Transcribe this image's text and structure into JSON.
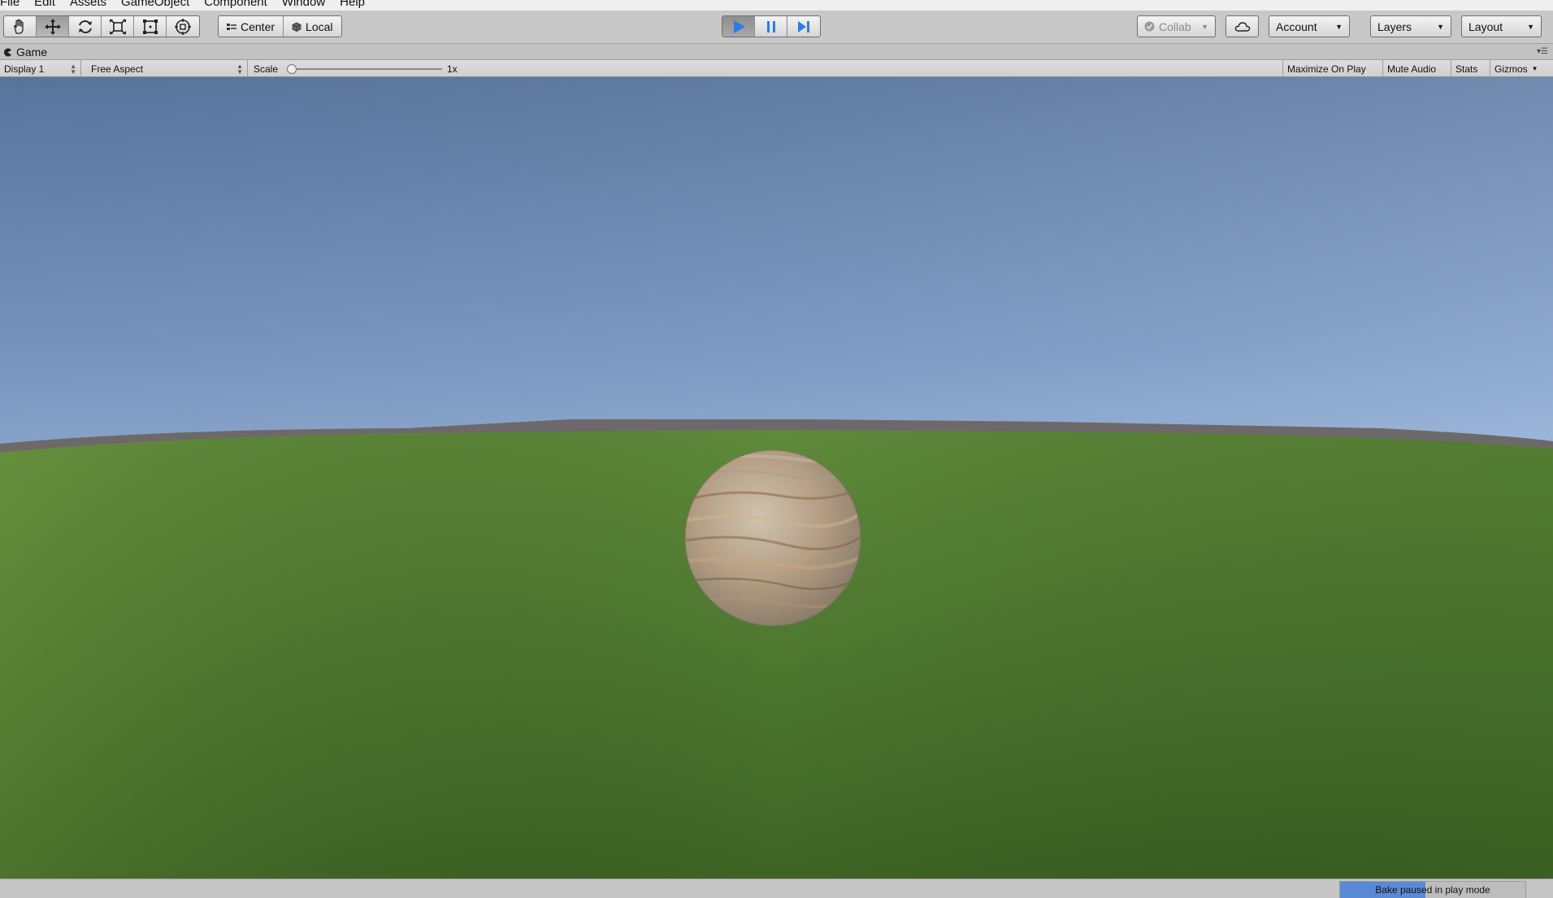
{
  "menu": {
    "items": [
      "File",
      "Edit",
      "Assets",
      "GameObject",
      "Component",
      "Window",
      "Help"
    ]
  },
  "toolbar": {
    "transform_tools": [
      {
        "name": "hand-tool-icon"
      },
      {
        "name": "move-tool-icon",
        "active": true
      },
      {
        "name": "rotate-tool-icon"
      },
      {
        "name": "scale-tool-icon"
      },
      {
        "name": "rect-tool-icon"
      },
      {
        "name": "transform-tool-icon"
      }
    ],
    "pivot_label": "Center",
    "rotation_label": "Local",
    "play_active": true,
    "collab_label": "Collab",
    "account_label": "Account",
    "layers_label": "Layers",
    "layout_label": "Layout"
  },
  "game_tab": {
    "title": "Game"
  },
  "game_toolbar": {
    "display": "Display 1",
    "aspect": "Free Aspect",
    "scale_label": "Scale",
    "scale_value": "1x",
    "maximize_on_play": "Maximize On Play",
    "mute_audio": "Mute Audio",
    "stats": "Stats",
    "gizmos": "Gizmos"
  },
  "scene": {
    "sky_top": "#5e7ba5",
    "sky_horizon": "#d6f3fb",
    "ground": "#4f7a31",
    "sphere_color": "#b9a48a"
  },
  "status": {
    "bake_text": "Bake paused in play mode",
    "bake_progress": 0.46
  },
  "colors": {
    "play_blue": "#2f7de1",
    "bake_blue": "#5a8ad6"
  }
}
